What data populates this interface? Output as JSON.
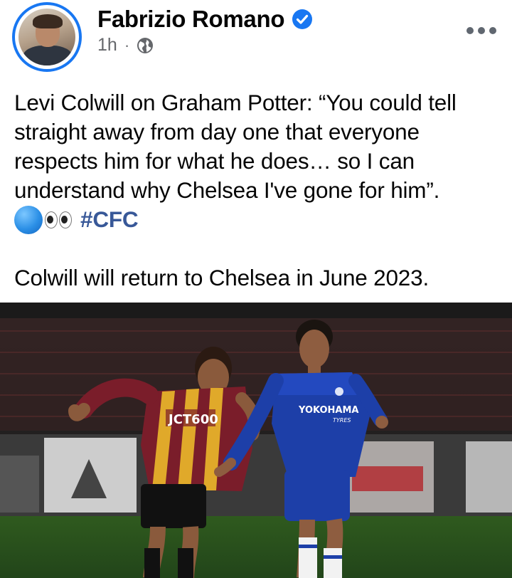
{
  "post": {
    "author": "Fabrizio Romano",
    "time": "1h",
    "separator": "·",
    "text_lines": [
      "Levi Colwill on Graham Potter: “You could tell",
      "straight away from day one that everyone",
      "respects him for what he does… so I can",
      "understand why Chelsea I've gone for him”."
    ],
    "hashtag": "#CFC",
    "followup": "Colwill will return to Chelsea in June 2023."
  },
  "photo": {
    "bradford_sponsor": "JCT600",
    "chelsea_sponsor": "YOKOHAMA",
    "chelsea_sponsor_sub": "TYRES"
  },
  "colors": {
    "verified_blue": "#1877f2",
    "hashtag": "#385898",
    "meta_grey": "#65676b"
  },
  "icons": [
    "verified-badge-icon",
    "globe-icon",
    "more-options-icon",
    "blue-circle-icon",
    "eyes-icon"
  ]
}
